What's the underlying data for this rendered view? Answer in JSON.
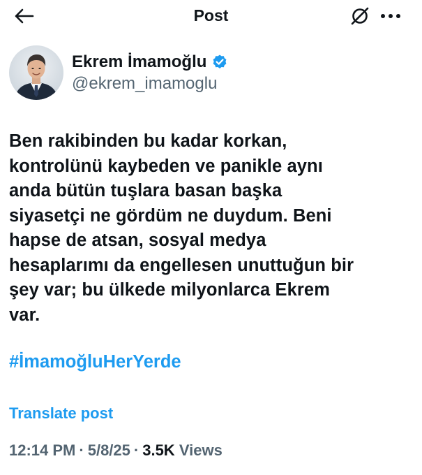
{
  "header": {
    "title": "Post",
    "back_icon": "arrow-left-icon",
    "grok_icon": "grok-icon",
    "more_icon": "more-horizontal-icon"
  },
  "author": {
    "name": "Ekrem İmamoğlu",
    "handle": "@ekrem_imamoglu",
    "verified": true,
    "verified_color": "#1d9bf0"
  },
  "post": {
    "text": "Ben rakibinden bu kadar korkan,\nkontrolünü kaybeden ve panikle aynı\nanda bütün tuşlara basan başka\nsiyasetçi ne gördüm ne duydum. Beni\nhapse de atsan, sosyal medya\nhesaplarımı da engellesen unuttuğun bir\nşey var; bu ülkede milyonlarca Ekrem\nvar.",
    "hashtag": "#İmamoğluHerYerde",
    "translate_label": "Translate post"
  },
  "meta": {
    "time": "12:14 PM",
    "separator": "·",
    "date": "5/8/25",
    "views_count": "3.5K",
    "views_label": "Views"
  },
  "colors": {
    "accent": "#1d9bf0",
    "text_primary": "#0f1419",
    "text_secondary": "#536471"
  }
}
